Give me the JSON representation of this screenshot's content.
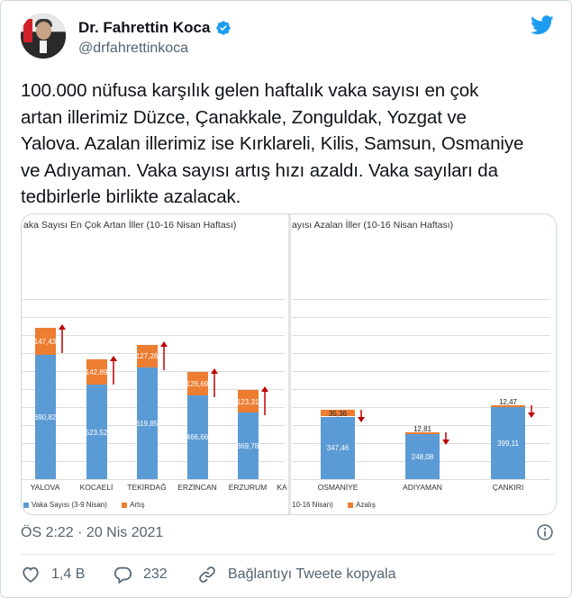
{
  "author": {
    "name": "Dr. Fahrettin Koca",
    "handle": "@drfahrettinkoca"
  },
  "tweet": {
    "lines": [
      "100.000 nüfusa karşılık gelen haftalık vaka sayısı en çok",
      "artan illerimiz Düzce, Çanakkale, Zonguldak, Yozgat ve",
      "Yalova. Azalan illerimiz ise Kırklareli, Kilis, Samsun, Osmaniye",
      "ve Adıyaman. Vaka sayısı artış hızı azaldı. Vaka sayıları da",
      "tedbirlerle birlikte azalacak."
    ],
    "timestamp": "ÖS 2:22 · 20 Nis 2021"
  },
  "actions": {
    "likes": "1,4 B",
    "replies": "232",
    "copy_link": "Bağlantıyı Tweete kopyala"
  },
  "colors": {
    "base": "#5b9bd5",
    "change": "#ed7d31",
    "arrow": "#c00000"
  },
  "chart_data": [
    {
      "type": "bar",
      "stacked": true,
      "title": "aka Sayısı En Çok Artan İller (10-16 Nisan Haftası)",
      "categories": [
        "YALOVA",
        "KOCAELİ",
        "TEKİRDAĞ",
        "ERZİNCAN",
        "ERZURUM",
        "KA"
      ],
      "series": [
        {
          "name": "Vaka Sayısı (3-9 Nisan)",
          "values": [
            690.82,
            523.52,
            619.85,
            466.66,
            369.78
          ]
        },
        {
          "name": "Artış",
          "values": [
            147.43,
            142.89,
            127.26,
            126.69,
            123.31
          ]
        }
      ],
      "value_labels": [
        [
          "690,82",
          "523,52",
          "619,85",
          "466,66",
          "369,78"
        ],
        [
          "147,43",
          "142,89",
          "127,26",
          "126,69",
          "123,31"
        ]
      ],
      "arrow": "up",
      "legend": "bottom",
      "grid": true
    },
    {
      "type": "bar",
      "stacked": true,
      "title": "ayısı Azalan İller (10-16 Nisan Haftası)",
      "categories": [
        "OSMANİYE",
        "ADIYAMAN",
        "ÇANKIRI"
      ],
      "series": [
        {
          "name": "10-16 Nisan)",
          "values": [
            347.46,
            248.08,
            399.11
          ]
        },
        {
          "name": "Azalış",
          "values": [
            35.36,
            12.81,
            12.47
          ]
        }
      ],
      "value_labels": [
        [
          "347,46",
          "248,08",
          "399,11"
        ],
        [
          "35,36",
          "12,81",
          "12,47"
        ]
      ],
      "arrow": "down",
      "legend": "bottom",
      "grid": true
    }
  ]
}
